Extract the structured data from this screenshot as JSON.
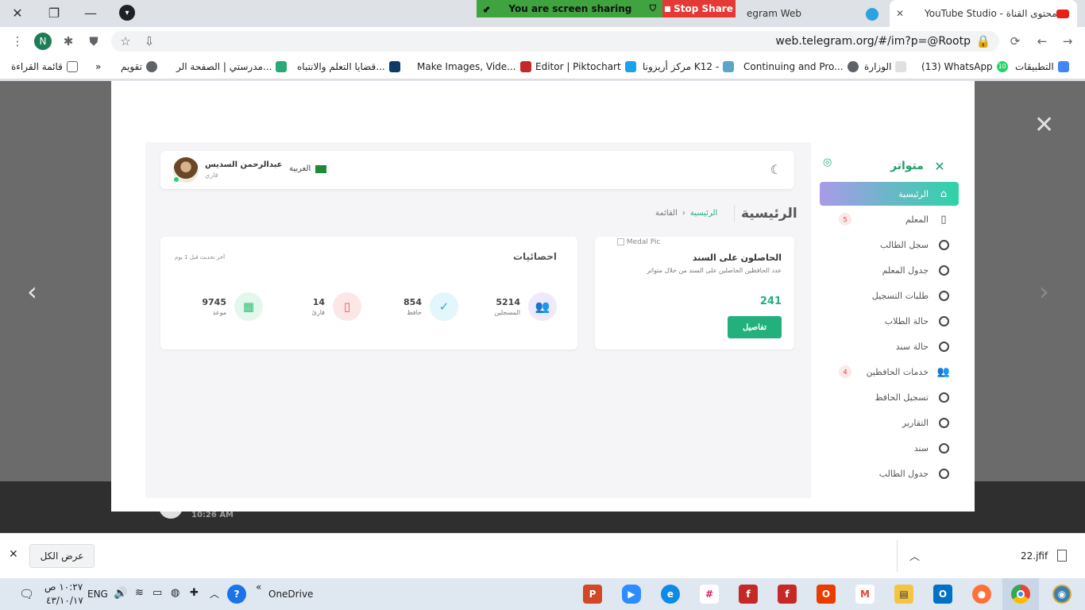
{
  "browser": {
    "tabs": [
      {
        "label": "egram Web"
      },
      {
        "label": "YouTube Studio - محتوى القناة"
      }
    ],
    "screen_share": {
      "message": "You are screen sharing",
      "stop_label": "Stop Share"
    },
    "url": "web.telegram.org/#/im?p=@Rootp",
    "profile_initial": "N",
    "bookmarks": [
      "التطبيقات",
      "(13) WhatsApp",
      "الوزارة",
      "Continuing and Pro...",
      "مركز أريزونا K12 -",
      "Editor | Piktochart",
      "Make Images, Vide...",
      "قضايا التعلم والانتباه...",
      "مدرستي | الصفحة الر...",
      "تقويم",
      "قائمة القراءة"
    ],
    "bookmarks_more": "»",
    "whatsapp_badge": "10"
  },
  "viewer": {
    "timestamp": "10:26 AM"
  },
  "dashboard": {
    "user": {
      "name": "عبدالرحمن السديس",
      "role": "قاري"
    },
    "language": "العربية",
    "page_title": "الرئيسية",
    "breadcrumb": {
      "current": "الرئيسية",
      "separator": "›",
      "parent": "القائمة"
    },
    "medal_card": {
      "image_alt": "Medal Pic",
      "title": "الحاصلون على السند",
      "description": "عدد الحافظين الحاصلين على السند من خلال متواتر",
      "count": "241",
      "details_label": "تفاصيل"
    },
    "stats": {
      "title": "احصائيات",
      "updated": "آخر تحديث قبل 1 يوم",
      "items": [
        {
          "value": "5214",
          "label": "المسجلين",
          "icon": "users-icon",
          "bg": "#eeeafb",
          "fg": "#7b6ad8"
        },
        {
          "value": "854",
          "label": "حافظ",
          "icon": "user-check-icon",
          "bg": "#e2f6fb",
          "fg": "#22b3d6"
        },
        {
          "value": "14",
          "label": "قارئ",
          "icon": "book-icon",
          "bg": "#fde6e6",
          "fg": "#e55a5a"
        },
        {
          "value": "9745",
          "label": "موعد",
          "icon": "calendar-icon",
          "bg": "#e3f7ec",
          "fg": "#2fbf71"
        }
      ]
    },
    "sidebar": {
      "brand": "متواتر",
      "items": [
        {
          "label": "الرئيسية",
          "icon": "home-icon",
          "active": true
        },
        {
          "label": "المعلم",
          "icon": "book-icon",
          "badge": "5"
        },
        {
          "label": "سجل الطالب",
          "icon": "circle-icon"
        },
        {
          "label": "جدول المعلم",
          "icon": "circle-icon"
        },
        {
          "label": "طلبات التسجيل",
          "icon": "circle-icon"
        },
        {
          "label": "حالة الطلاب",
          "icon": "circle-icon"
        },
        {
          "label": "حالة سند",
          "icon": "circle-icon"
        },
        {
          "label": "خدمات الحافظين",
          "icon": "users-icon",
          "badge": "4"
        },
        {
          "label": "تسجيل الحافظ",
          "icon": "circle-icon"
        },
        {
          "label": "التقارير",
          "icon": "circle-icon"
        },
        {
          "label": "سند",
          "icon": "circle-icon"
        },
        {
          "label": "جدول الطالب",
          "icon": "circle-icon"
        }
      ]
    }
  },
  "downloads": {
    "show_all": "عرض الكل",
    "file": "22.jfif"
  },
  "taskbar": {
    "time": "١٠:٢٧ ص",
    "date": "٤٣/١٠/١٧",
    "lang": "ENG",
    "onedrive": "OneDrive",
    "chevron": "«"
  },
  "colors": {
    "accent": "#22b07d",
    "brand": "#22a06b"
  }
}
